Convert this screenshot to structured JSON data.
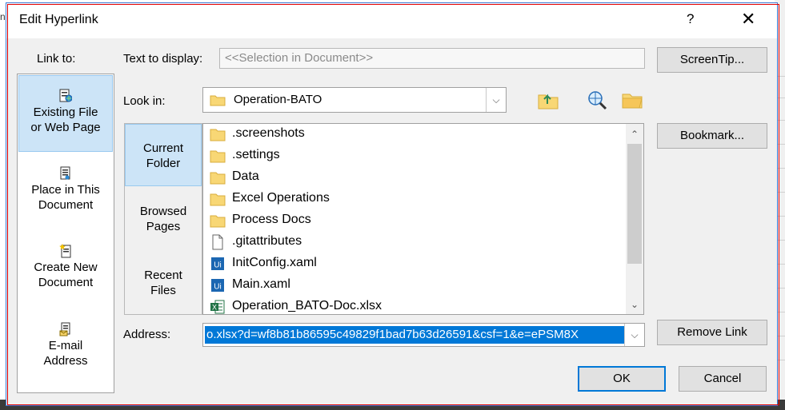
{
  "dialog": {
    "title": "Edit Hyperlink",
    "help_glyph": "?",
    "close_glyph": "✕"
  },
  "link_to": {
    "label": "Link to:",
    "items": [
      {
        "line1": "Existing File",
        "line2": "or Web Page",
        "icon": "existing-file-icon",
        "selected": true
      },
      {
        "line1": "Place in This",
        "line2": "Document",
        "icon": "place-in-document-icon",
        "selected": false
      },
      {
        "line1": "Create New",
        "line2": "Document",
        "icon": "create-new-document-icon",
        "selected": false
      },
      {
        "line1": "E-mail",
        "line2": "Address",
        "icon": "email-address-icon",
        "selected": false
      }
    ]
  },
  "text_to_display": {
    "label": "Text to display:",
    "value": "<<Selection in Document>>"
  },
  "screentip_button": "ScreenTip...",
  "look_in": {
    "label": "Look in:",
    "value": "Operation-BATO",
    "arrow_glyph": "⌵"
  },
  "nav": [
    {
      "line1": "Current",
      "line2": "Folder",
      "selected": true
    },
    {
      "line1": "Browsed",
      "line2": "Pages",
      "selected": false
    },
    {
      "line1": "Recent",
      "line2": "Files",
      "selected": false
    }
  ],
  "files": [
    {
      "name": ".screenshots",
      "type": "folder"
    },
    {
      "name": ".settings",
      "type": "folder"
    },
    {
      "name": "Data",
      "type": "folder"
    },
    {
      "name": "Excel Operations",
      "type": "folder"
    },
    {
      "name": "Process Docs",
      "type": "folder"
    },
    {
      "name": ".gitattributes",
      "type": "file"
    },
    {
      "name": "InitConfig.xaml",
      "type": "uipath"
    },
    {
      "name": "Main.xaml",
      "type": "uipath"
    },
    {
      "name": "Operation_BATO-Doc.xlsx",
      "type": "excel"
    }
  ],
  "bookmark_button": "Bookmark...",
  "address": {
    "label": "Address:",
    "value": "o.xlsx?d=wf8b81b86595c49829f1bad7b63d26591&csf=1&e=ePSM8X"
  },
  "remove_link_button": "Remove Link",
  "ok_button": "OK",
  "cancel_button": "Cancel",
  "colors": {
    "accent": "#0078d7",
    "selection": "#cce4f7",
    "frame_highlight": "#e00000"
  }
}
